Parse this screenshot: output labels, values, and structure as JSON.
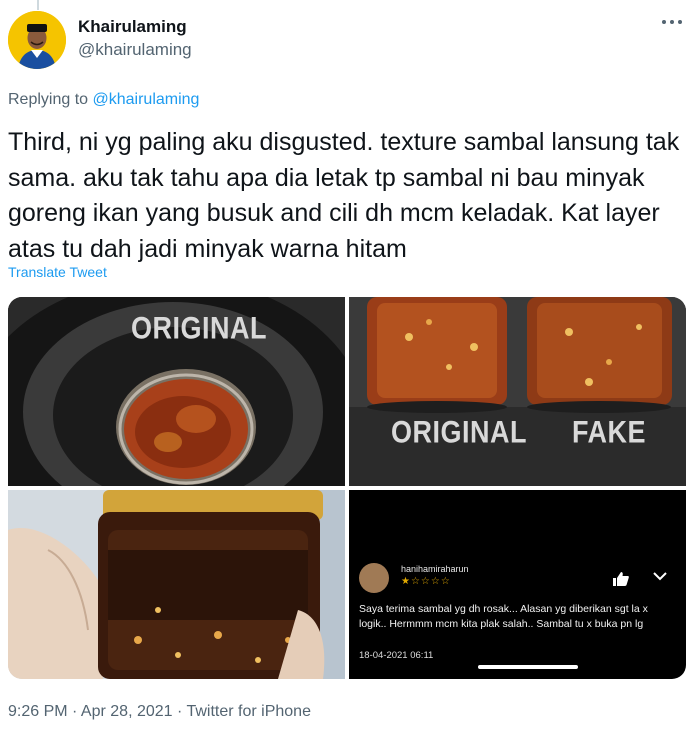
{
  "tweet": {
    "display_name": "Khairulaming",
    "handle": "@khairulaming",
    "replying_prefix": "Replying to",
    "replying_to": "@khairulaming",
    "text": "Third, ni yg paling aku disgusted. texture sambal lansung tak sama. aku tak tahu apa dia letak tp sambal ni bau minyak goreng ikan yang busuk and cili dh mcm keladak. Kat layer atas tu dah jadi minyak warna hitam",
    "translate_label": "Translate Tweet",
    "timestamp": "9:26 PM · Apr 28, 2021 · Twitter for iPhone"
  },
  "icons": {
    "more": "more-horizontal-icon",
    "thumbs_up": "thumbs-up-icon",
    "chevron": "chevron-down-icon"
  },
  "media": {
    "photo1": {
      "label": "ORIGINAL"
    },
    "photo2": {
      "label_left": "ORIGINAL",
      "label_right": "FAKE"
    },
    "photo4": {
      "reviewer": "hanihamiraharun",
      "stars": "★☆☆☆☆",
      "review_text": "Saya terima sambal yg dh rosak... Alasan yg diberikan sgt la x logik.. Hermmm mcm kita plak salah.. Sambal tu x buka pn lg",
      "review_date": "18-04-2021 06:11"
    }
  },
  "colors": {
    "link": "#1d9bf0",
    "secondary_text": "#536471",
    "primary_text": "#0f1419",
    "avatar_bg": "#f5c400"
  }
}
